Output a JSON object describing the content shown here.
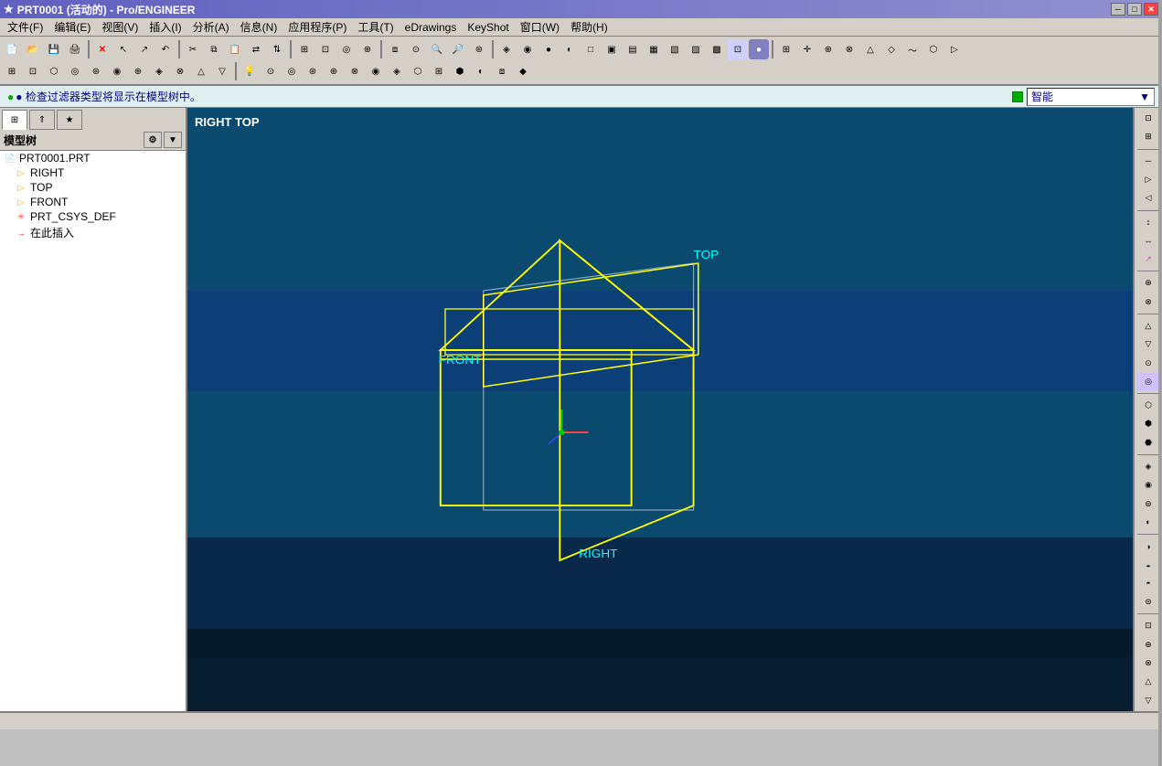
{
  "titlebar": {
    "title": "PRT0001 (活动的) - Pro/ENGINEER",
    "icon": "★",
    "minimize": "─",
    "maximize": "□",
    "close": "✕"
  },
  "menubar": {
    "items": [
      {
        "label": "文件(F)"
      },
      {
        "label": "编辑(E)"
      },
      {
        "label": "视图(V)"
      },
      {
        "label": "插入(I)"
      },
      {
        "label": "分析(A)"
      },
      {
        "label": "信息(N)"
      },
      {
        "label": "应用程序(P)"
      },
      {
        "label": "工具(T)"
      },
      {
        "label": "eDrawings"
      },
      {
        "label": "KeyShot"
      },
      {
        "label": "窗口(W)"
      },
      {
        "label": "帮助(H)"
      }
    ]
  },
  "statusbar": {
    "message": "● 检查过滤器类型将显示在模型树中。",
    "smart_label": "智能",
    "indicator_color": "#00aa00"
  },
  "left_panel": {
    "tabs": [
      {
        "icon": "⊞",
        "active": true
      },
      {
        "icon": "⇑",
        "active": false
      },
      {
        "icon": "★",
        "active": false
      }
    ],
    "tree_title": "模型树",
    "tree_items": [
      {
        "label": "PRT0001.PRT",
        "icon": "📄",
        "level": 0,
        "icon_color": "#4080ff"
      },
      {
        "label": "RIGHT",
        "icon": "▷",
        "level": 1,
        "icon_color": "#ffaa00"
      },
      {
        "label": "TOP",
        "icon": "▷",
        "level": 1,
        "icon_color": "#ffaa00"
      },
      {
        "label": "FRONT",
        "icon": "▷",
        "level": 1,
        "icon_color": "#ffaa00"
      },
      {
        "label": "PRT_CSYS_DEF",
        "icon": "✳",
        "level": 1,
        "icon_color": "#ff4040"
      },
      {
        "label": "在此插入",
        "icon": "→",
        "level": 1,
        "icon_color": "#ff0000"
      }
    ]
  },
  "viewport": {
    "label": "RIGHT TOP",
    "planes": {
      "top_label": "TOP",
      "front_label": "FRONT",
      "right_label": "RIGHT"
    }
  },
  "right_toolbar": {
    "buttons": [
      "⊡",
      "⊞",
      "─",
      "▷",
      "◁",
      "↕",
      "↔",
      "⊕",
      "⊗",
      "△",
      "▽",
      "⊙",
      "◎",
      "⬡",
      "⬢",
      "⬣",
      "◈",
      "◉",
      "⊛",
      "◐",
      "◑",
      "◒",
      "◓",
      "⊜"
    ]
  },
  "bottom_bar": {
    "text": ""
  }
}
